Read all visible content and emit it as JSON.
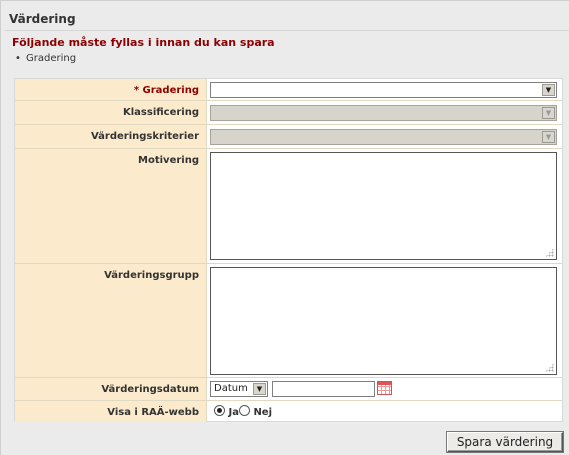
{
  "panel": {
    "title": "Värdering"
  },
  "errors": {
    "heading": "Följande måste fyllas i innan du kan spara",
    "items": [
      "Gradering"
    ]
  },
  "form": {
    "gradering": {
      "required_mark": "*",
      "label": "Gradering",
      "value": ""
    },
    "klassificering": {
      "label": "Klassificering",
      "value": "",
      "disabled": true
    },
    "varderingskriterier": {
      "label": "Värderingskriterier",
      "value": "",
      "disabled": true
    },
    "motivering": {
      "label": "Motivering",
      "value": ""
    },
    "varderingsgrupp": {
      "label": "Värderingsgrupp",
      "value": ""
    },
    "varderingsdatum": {
      "label": "Värderingsdatum",
      "date_type": "Datum",
      "value": ""
    },
    "visa_raa_webb": {
      "label": "Visa i RAÄ-webb",
      "option_yes": "Ja",
      "option_no": "Nej",
      "selected": "Ja"
    }
  },
  "actions": {
    "save_label": "Spara värdering"
  },
  "icons": {
    "dropdown": "chevron-down-icon",
    "calendar": "calendar-icon",
    "resize": "resize-grip-icon"
  },
  "colors": {
    "label_bg": "#fbebcc",
    "error_text": "#8b0000",
    "panel_bg": "#ebebeb"
  }
}
